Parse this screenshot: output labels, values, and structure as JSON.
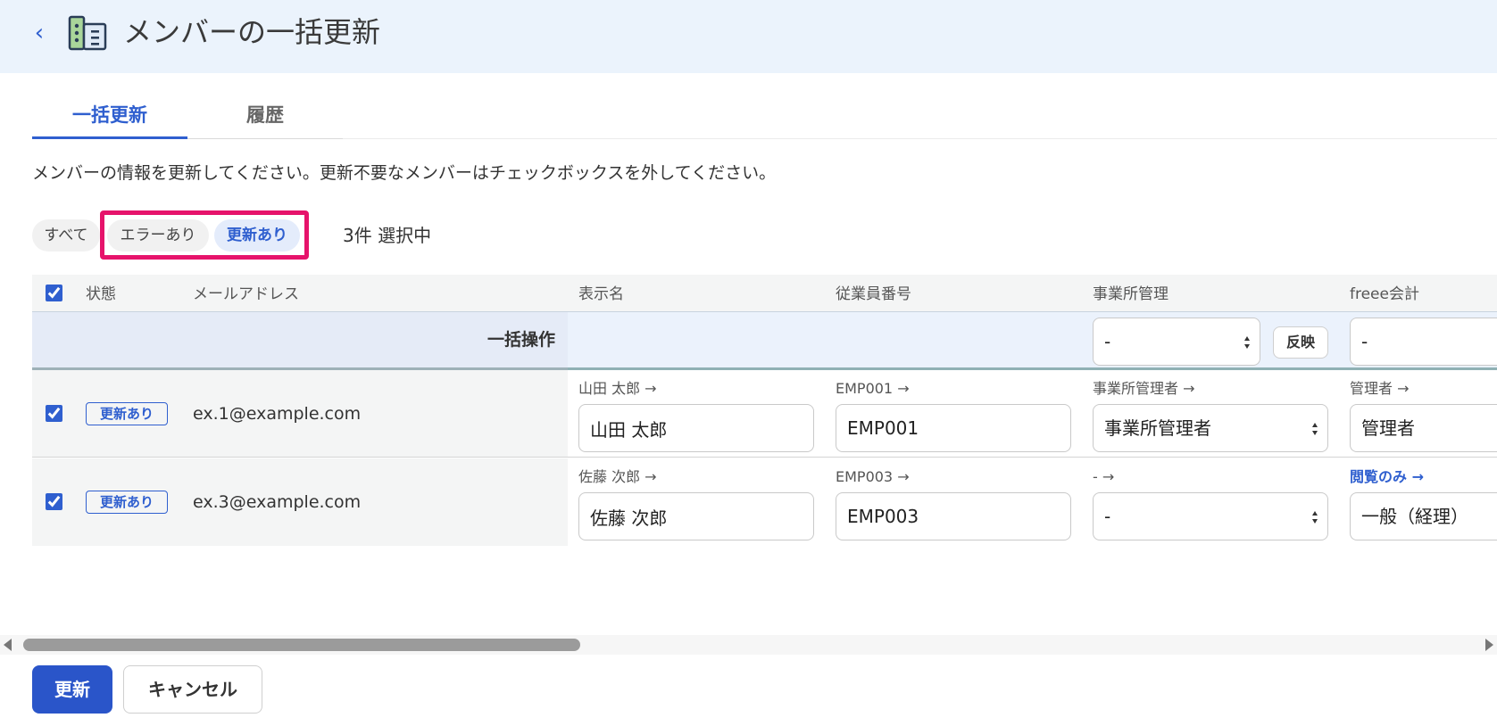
{
  "header": {
    "back_label": "‹",
    "title": "メンバーの一括更新"
  },
  "tabs": [
    {
      "label": "一括更新",
      "active": true
    },
    {
      "label": "履歴",
      "active": false
    }
  ],
  "description": "メンバーの情報を更新してください。更新不要なメンバーはチェックボックスを外してください。",
  "filters": {
    "all": "すべて",
    "error": "エラーあり",
    "updated": "更新あり",
    "selected_count": "3件 選択中"
  },
  "table": {
    "columns": {
      "status": "状態",
      "email": "メールアドレス",
      "display_name": "表示名",
      "employee_no": "従業員番号",
      "office_admin": "事業所管理",
      "freee_accounting": "freee会計"
    },
    "bulk": {
      "label": "一括操作",
      "office_admin_value": "-",
      "apply_label": "反映",
      "freee_value": "-"
    },
    "rows": [
      {
        "checked": true,
        "status": "更新あり",
        "email": "ex.1@example.com",
        "display_name_old": "山田 太郎 →",
        "display_name": "山田 太郎",
        "employee_no_old": "EMP001 →",
        "employee_no": "EMP001",
        "office_admin_old": "事業所管理者 →",
        "office_admin": "事業所管理者",
        "freee_old": "管理者 →",
        "freee": "管理者"
      },
      {
        "checked": true,
        "status": "更新あり",
        "email": "ex.3@example.com",
        "display_name_old": "佐藤 次郎 →",
        "display_name": "佐藤 次郎",
        "employee_no_old": "EMP003 →",
        "employee_no": "EMP003",
        "office_admin_old": "- →",
        "office_admin": "-",
        "freee_old": "閲覧のみ →",
        "freee": "一般（経理）"
      }
    ]
  },
  "actions": {
    "submit": "更新",
    "cancel": "キャンセル"
  },
  "colors": {
    "accent": "#2f5fcf",
    "highlight": "#e6136b",
    "header_bg": "#ebf3fc"
  }
}
